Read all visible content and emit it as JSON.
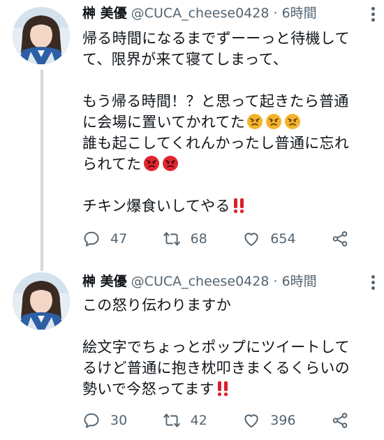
{
  "tweets": [
    {
      "name": "榊 美優",
      "handle": "@CUCA_cheese0428",
      "separator": "·",
      "time": "6時間",
      "lines": [
        "帰る時間になるまでずーーっと待機して",
        "て、限界が来て寝てしまって、",
        "",
        "もう帰る時間！？と思って起きたら普通",
        "に会場に置いてかれてた",
        "誰も起こしてくれんかったし普通に忘れ",
        "られてた",
        "",
        "チキン爆食いしてやる"
      ],
      "emojis": {
        "line_4": [
          "angry-face",
          "angry-face",
          "angry-face"
        ],
        "line_6": [
          "pouting-face",
          "pouting-face"
        ],
        "line_8": [
          "double-exclamation"
        ]
      },
      "stats": {
        "replies": "47",
        "retweets": "68",
        "likes": "654"
      }
    },
    {
      "name": "榊 美優",
      "handle": "@CUCA_cheese0428",
      "separator": "·",
      "time": "6時間",
      "lines": [
        "この怒り伝わりますか",
        "",
        "絵文字でちょっとポップにツイートして",
        "るけど普通に抱き枕叩きまくるくらいの",
        "勢いで今怒ってます"
      ],
      "emojis": {
        "line_4": [
          "double-exclamation"
        ]
      },
      "stats": {
        "replies": "30",
        "retweets": "42",
        "likes": "396"
      }
    }
  ],
  "colors": {
    "text": "#0f1419",
    "secondary": "#536471",
    "thread_line": "#cfd9de",
    "angry_face": "#f4b42a",
    "pouting_face": "#e0262e",
    "exclamation": "#d9212c"
  }
}
